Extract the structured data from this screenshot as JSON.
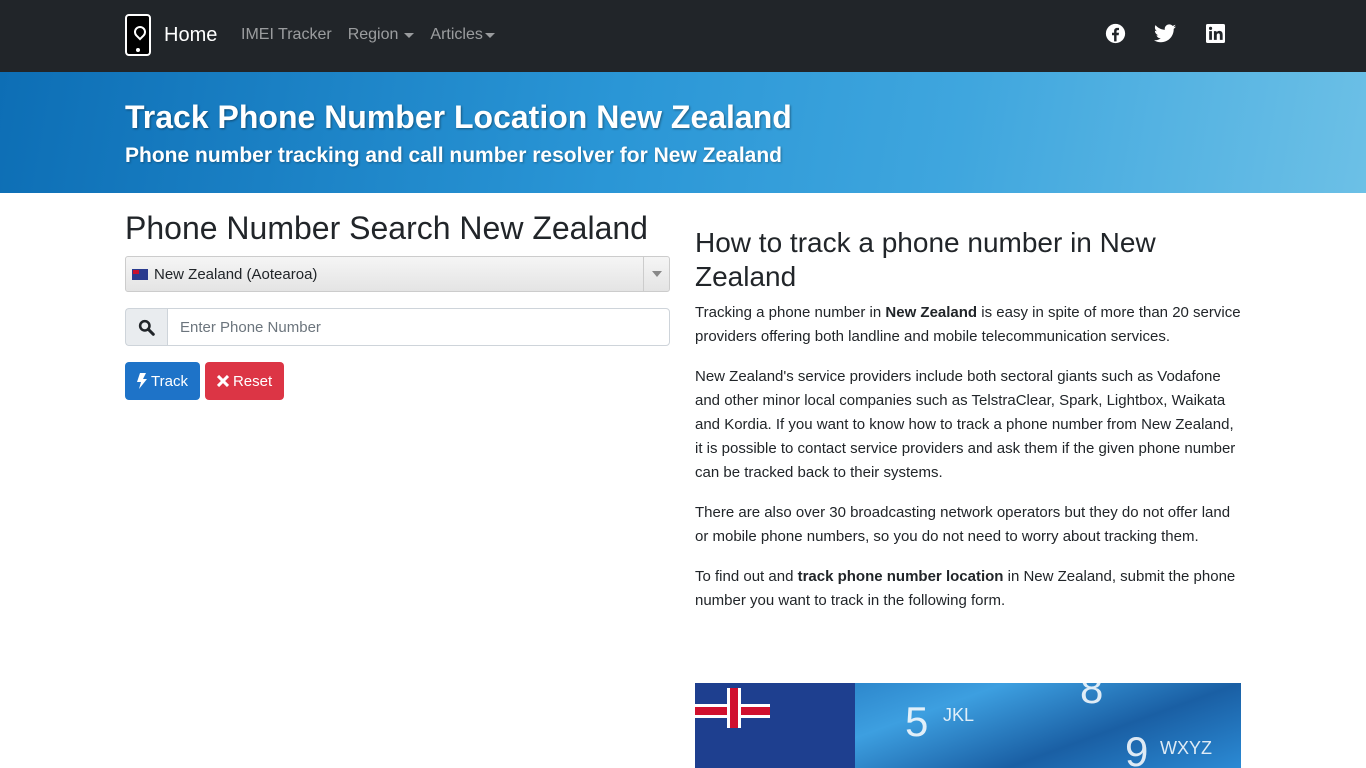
{
  "navbar": {
    "brand_label": "Home",
    "items": [
      {
        "label": "IMEI Tracker",
        "dropdown": false
      },
      {
        "label": "Region",
        "dropdown": true
      },
      {
        "label": "Articles",
        "dropdown": true
      }
    ],
    "social": [
      "facebook-icon",
      "twitter-icon",
      "linkedin-icon"
    ]
  },
  "hero": {
    "title": "Track Phone Number Location New Zealand",
    "subtitle": "Phone number tracking and call number resolver for New Zealand"
  },
  "search": {
    "heading": "Phone Number Search New Zealand",
    "country_selected": "New Zealand (Aotearoa)",
    "phone_placeholder": "Enter Phone Number",
    "phone_value": "",
    "track_label": "Track",
    "reset_label": "Reset"
  },
  "article": {
    "heading": "How to track a phone number in New Zealand",
    "p1_a": "Tracking a phone number in ",
    "p1_b": "New Zealand",
    "p1_c": " is easy in spite of more than 20 service providers offering both landline and mobile telecommunication services.",
    "p2": "New Zealand's service providers include both sectoral giants such as Vodafone and other minor local companies such as TelstraClear, Spark, Lightbox, Waikata and Kordia. If you want to know how to track a phone number from New Zealand, it is possible to contact service providers and ask them if the given phone number can be tracked back to their systems.",
    "p3": "There are also over 30 broadcasting network operators but they do not offer land or mobile phone numbers, so you do not need to worry about tracking them.",
    "p4_a": "To find out and ",
    "p4_b": "track phone number location",
    "p4_c": " in New Zealand, submit the phone number you want to track in the following form.",
    "banner": {
      "key1": "5",
      "key1_letters": "JKL",
      "key2": "9",
      "key2_letters": "WXYZ",
      "key3": "8"
    }
  }
}
